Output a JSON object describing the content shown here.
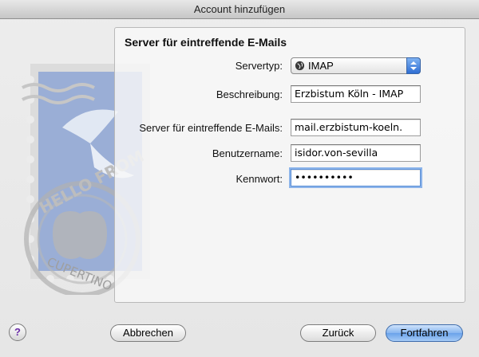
{
  "window": {
    "title": "Account hinzufügen"
  },
  "panel": {
    "title": "Server für eintreffende E-Mails"
  },
  "form": {
    "server_type_label": "Servertyp:",
    "server_type_value": "IMAP",
    "description_label": "Beschreibung:",
    "description_value": "Erzbistum Köln - IMAP",
    "incoming_server_label": "Server für eintreffende E-Mails:",
    "incoming_server_value": "mail.erzbistum-koeln.",
    "username_label": "Benutzername:",
    "username_value": "isidor.von-sevilla",
    "password_label": "Kennwort:",
    "password_value": "••••••••••"
  },
  "buttons": {
    "help": "?",
    "cancel": "Abbrechen",
    "back": "Zurück",
    "continue": "Fortfahren"
  },
  "stamp": {
    "text_top": "HELLO FROM",
    "text_bottom": "CUPERTINO"
  },
  "colors": {
    "accent": "#5b8fd6",
    "default_button": "#6aa2ea",
    "help_glyph": "#6a2da8"
  }
}
